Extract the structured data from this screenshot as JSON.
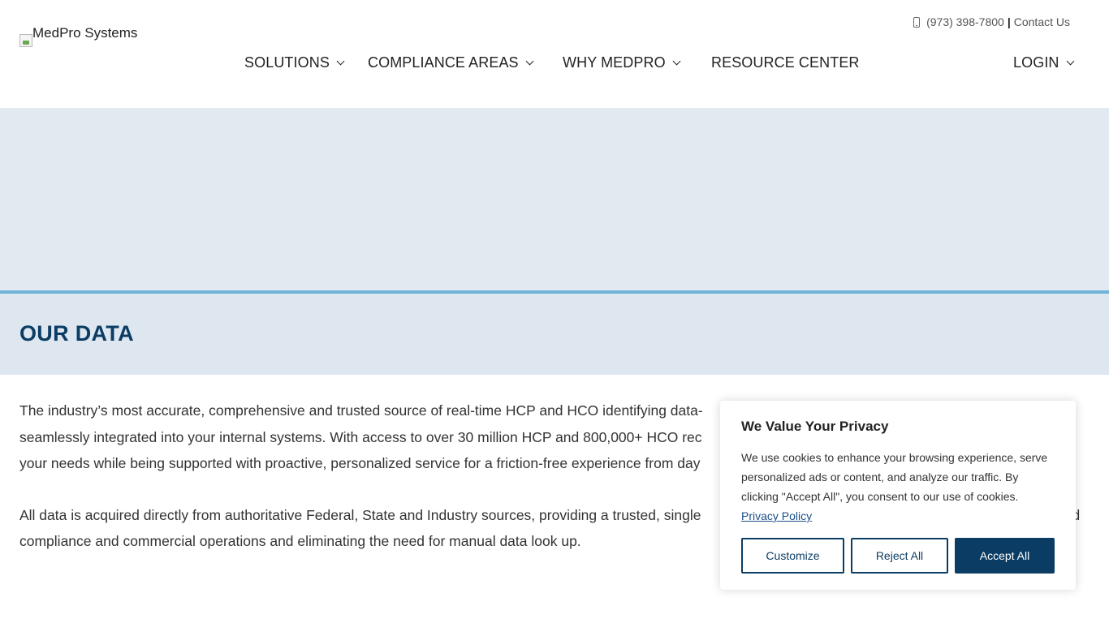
{
  "logo": {
    "alt": "MedPro Systems"
  },
  "topbar": {
    "phone": "(973) 398-7800",
    "separator": "|",
    "contact": "Contact Us"
  },
  "nav": {
    "items": [
      {
        "label": "SOLUTIONS",
        "has_menu": true
      },
      {
        "label": "COMPLIANCE AREAS",
        "has_menu": true
      },
      {
        "label": "WHY MEDPRO",
        "has_menu": true
      },
      {
        "label": "RESOURCE CENTER",
        "has_menu": false
      }
    ],
    "login": "LOGIN"
  },
  "page": {
    "title": "OUR DATA",
    "paragraphs": [
      [
        "The industry’s most accurate, comprehensive and trusted source of real-time HCP and HCO identifying data-",
        "seamlessly integrated into your internal systems. With access to over 30 million HCP and 800,000+ HCO rec",
        "your needs while being supported with proactive, personalized service for a friction-free experience from day"
      ],
      [
        "All data is acquired directly from authoritative Federal, State and Industry sources, providing a trusted, single                                                                                              d",
        "compliance and commercial operations and eliminating the need for manual data look up."
      ]
    ]
  },
  "cookie": {
    "title": "We Value Your Privacy",
    "body": "We use cookies to enhance your browsing experience, serve personalized ads or content, and analyze our traffic. By clicking \"Accept All\", you consent to our use of cookies.",
    "policy_link": "Privacy Policy",
    "buttons": {
      "customize": "Customize",
      "reject": "Reject All",
      "accept": "Accept All"
    }
  },
  "colors": {
    "brand_navy": "#0b3d64",
    "accent_blue": "#6fb3da",
    "hero_bg": "#e3e9f0"
  }
}
